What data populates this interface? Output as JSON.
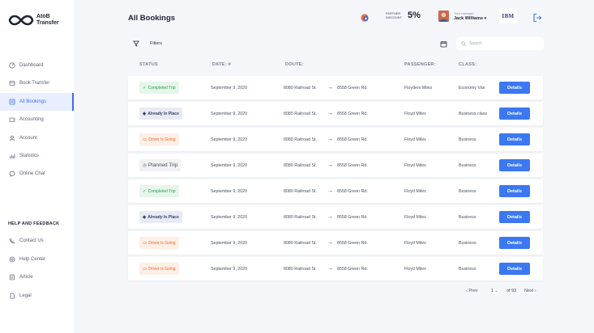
{
  "brand": {
    "name_line1": "AtoB",
    "name_line2": "Transfer",
    "icon": "infinity-logo-icon",
    "color": "#1d2433"
  },
  "nav": [
    {
      "label": "Dashboard",
      "icon": "dashboard-icon"
    },
    {
      "label": "Book Transfer",
      "icon": "book-icon"
    },
    {
      "label": "All Bookings",
      "icon": "bookings-icon",
      "active": true
    },
    {
      "label": "Accounting",
      "icon": "wallet-icon"
    },
    {
      "label": "Account",
      "icon": "user-icon"
    },
    {
      "label": "Statistics",
      "icon": "chart-icon"
    },
    {
      "label": "Online Chat",
      "icon": "chat-icon"
    }
  ],
  "help_section": {
    "title": "HELP AND FEEDBACK",
    "items": [
      {
        "label": "Contact Us",
        "icon": "phone-icon"
      },
      {
        "label": "Help Center",
        "icon": "help-icon"
      },
      {
        "label": "Article",
        "icon": "article-icon"
      },
      {
        "label": "Legal",
        "icon": "legal-icon"
      }
    ]
  },
  "header": {
    "title": "All Bookings",
    "partner_label_1": "PARTNER",
    "partner_label_2": "DISCOUNT",
    "partner_value": "5%",
    "manager_label": "Your manager",
    "manager_name": "Jack Williams",
    "company_logo": "IBM"
  },
  "toolbar": {
    "filters_label": "Filters",
    "search_placeholder": "Search"
  },
  "columns": {
    "status": "STATUS",
    "date": "DATE: #",
    "route": "DOUTE:",
    "passenger": "PASSENGER:",
    "class": "CLASS:"
  },
  "rows": [
    {
      "status": "Completed Trip",
      "status_type": "completed",
      "date": "September 9, 2020",
      "from": "8080 Railroad St.",
      "to": "8558 Green Rd.",
      "passenger": "Floyders Miles",
      "class": "Economy Van",
      "action": "Details"
    },
    {
      "status": "Already In Place",
      "status_type": "already",
      "date": "September 9, 2020",
      "from": "8080 Railroad St.",
      "to": "8558 Green Rd.",
      "passenger": "Floyd Miles",
      "class": "Business class",
      "action": "Details"
    },
    {
      "status": "Driver Is Going",
      "status_type": "driver",
      "date": "September 9, 2020",
      "from": "8080 Railroad St.",
      "to": "8558 Green Rd.",
      "passenger": "Floyd Miles",
      "class": "Business",
      "action": "Details"
    },
    {
      "status": "Planned Trip",
      "status_type": "planned",
      "date": "September 9, 2020",
      "from": "8080 Railroad St.",
      "to": "8558 Green Rd.",
      "passenger": "Floyd Miles",
      "class": "Business",
      "action": "Details"
    },
    {
      "status": "Completed Trip",
      "status_type": "completed",
      "date": "September 9, 2020",
      "from": "8080 Railroad St.",
      "to": "8558 Green Rd.",
      "passenger": "Floyd Miles",
      "class": "Business",
      "action": "Details"
    },
    {
      "status": "Already In Place",
      "status_type": "already",
      "date": "September 9, 2020",
      "from": "8080 Railroad St.",
      "to": "8558 Green Rd.",
      "passenger": "Floyd Miles",
      "class": "Business",
      "action": "Details"
    },
    {
      "status": "Driver Is Going",
      "status_type": "driver",
      "date": "September 9, 2020",
      "from": "8080 Railroad St.",
      "to": "8558 Green Rd.",
      "passenger": "Floyd Miles",
      "class": "Business",
      "action": "Details"
    },
    {
      "status": "Driver Is Going",
      "status_type": "driver",
      "date": "September 9, 2020",
      "from": "8080 Railroad St.",
      "to": "8558 Green Rd.",
      "passenger": "Floyd Miles",
      "class": "Business",
      "action": "Details"
    }
  ],
  "pagination": {
    "prev": "Prev",
    "page": "1",
    "of": "of 93",
    "next": "Next"
  },
  "colors": {
    "accent": "#3b78f2",
    "completed": "#2f9a4a",
    "driver": "#e56b2e",
    "already": "#3a3f6a"
  }
}
